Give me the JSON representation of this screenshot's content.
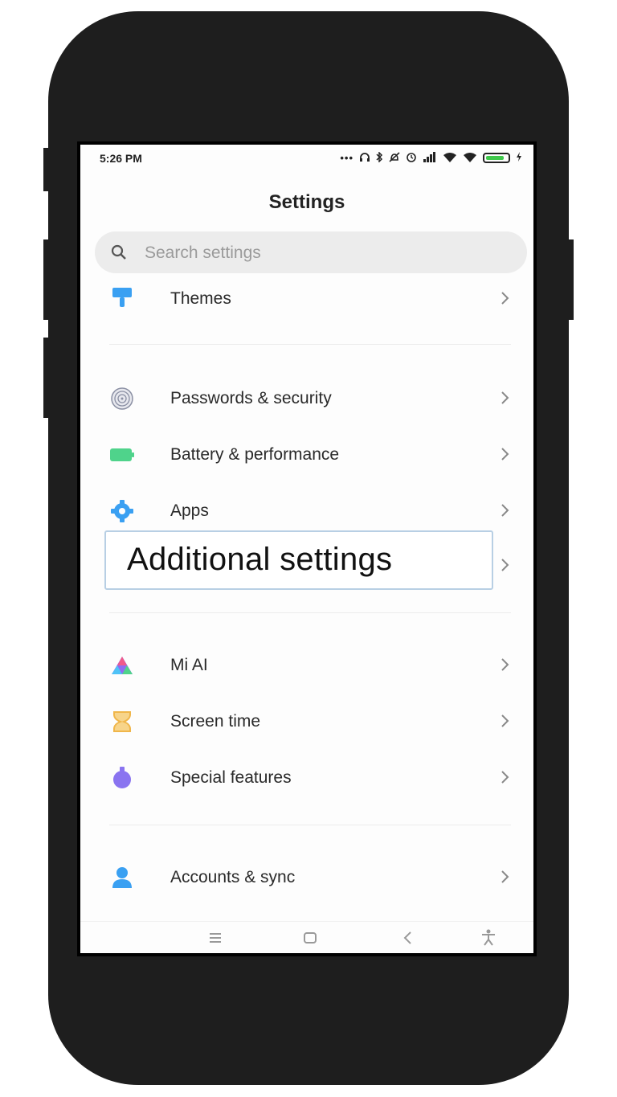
{
  "status_bar": {
    "time": "5:26 PM",
    "icons": [
      "more-dots-icon",
      "headphones-icon",
      "bluetooth-icon",
      "mute-icon",
      "alarm-icon",
      "signal-icon",
      "wifi-icon",
      "battery-icon",
      "charging-icon"
    ]
  },
  "header": {
    "title": "Settings"
  },
  "search": {
    "placeholder": "Search settings"
  },
  "items": [
    {
      "label": "Themes",
      "icon": "themes-icon",
      "color": "#3aa0f2"
    },
    {
      "label": "Passwords & security",
      "icon": "fingerprint-icon",
      "color": "#8a8fa3"
    },
    {
      "label": "Battery & performance",
      "icon": "battery-icon",
      "color": "#4fd38b"
    },
    {
      "label": "Apps",
      "icon": "gear-icon",
      "color": "#3aa0f2"
    },
    {
      "label": "Mi AI",
      "icon": "mi-ai-icon",
      "color": "#8e6cf2"
    },
    {
      "label": "Screen time",
      "icon": "hourglass-icon",
      "color": "#f0b64a"
    },
    {
      "label": "Special features",
      "icon": "special-features-icon",
      "color": "#8a74f0"
    },
    {
      "label": "Accounts & sync",
      "icon": "account-icon",
      "color": "#3aa0f2"
    }
  ],
  "highlighted_item": {
    "label": "Additional settings"
  },
  "navigation_bar": {
    "buttons": [
      "menu-icon",
      "home-icon",
      "back-icon",
      "accessibility-icon"
    ]
  }
}
